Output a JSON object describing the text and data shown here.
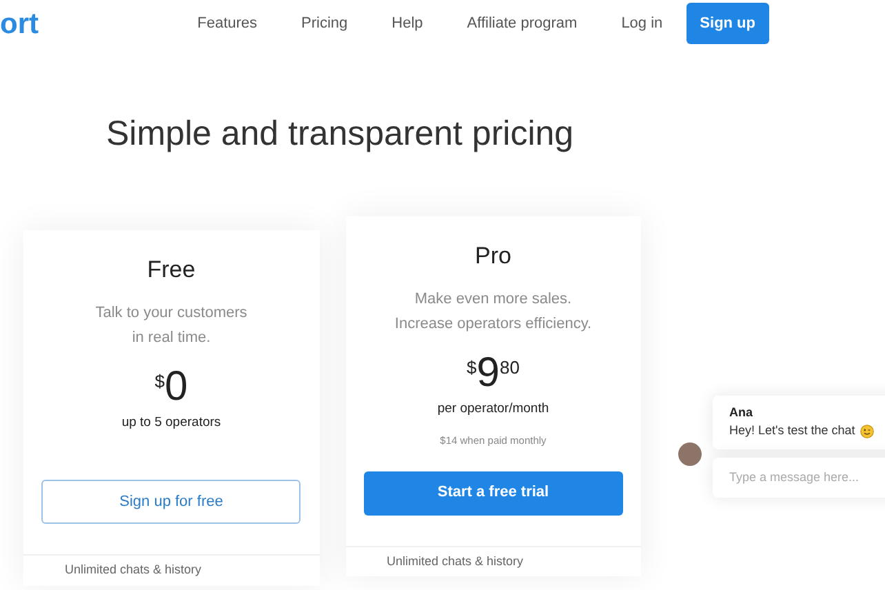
{
  "header": {
    "logo": "ort",
    "nav": [
      "Features",
      "Pricing",
      "Help",
      "Affiliate program",
      "Log in"
    ],
    "signup": "Sign up"
  },
  "title": "Simple and transparent pricing",
  "plans": [
    {
      "kind": "free",
      "name": "Free",
      "description": [
        "Talk to your customers",
        "in real time."
      ],
      "currency": "$",
      "price": "0",
      "unit": "up to 5 operators",
      "cta": "Sign up for free",
      "feature": "Unlimited chats & history"
    },
    {
      "kind": "pro",
      "name": "Pro",
      "description": [
        "Make even more sales.",
        "Increase operators efficiency."
      ],
      "currency": "$",
      "price": "9",
      "cents": "80",
      "unit": "per operator/month",
      "note": "$14 when paid monthly",
      "cta": "Start a free trial",
      "feature": "Unlimited chats & history"
    }
  ],
  "chat": {
    "sender": "Ana",
    "message": "Hey! Let's test the chat",
    "placeholder": "Type a message here..."
  }
}
